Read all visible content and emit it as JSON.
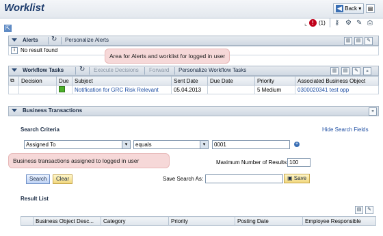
{
  "header": {
    "title": "Worklist",
    "back_label": "Back",
    "alert_count": "(1)"
  },
  "alerts": {
    "title": "Alerts",
    "personalize_label": "Personalize Alerts",
    "no_result": "No result found"
  },
  "callouts": {
    "alerts": "Area for Alerts and worklist for logged in user",
    "business": "Business transactions assigned to logged in user"
  },
  "workflow": {
    "title": "Workflow Tasks",
    "execute_label": "Execute Decisions",
    "forward_label": "Forward",
    "personalize_label": "Personalize Workflow Tasks",
    "columns": [
      "Decision",
      "Due",
      "Subject",
      "Sent Date",
      "Due Date",
      "Priority",
      "Associated Business Object"
    ],
    "rows": [
      {
        "decision": "",
        "subject": "Notification for GRC Risk Relevant",
        "sent_date": "05.04.2013",
        "due_date": "",
        "priority": "5 Medium",
        "object": "0300020341 test opp"
      }
    ]
  },
  "business": {
    "title": "Business Transactions",
    "search_criteria": "Search Criteria",
    "hide_search": "Hide Search Fields",
    "field": "Assigned To",
    "operator": "equals",
    "value": "0001",
    "max_results_label": "Maximum Number of Results:",
    "max_results_value": "100",
    "search_label": "Search",
    "clear_label": "Clear",
    "save_search_label": "Save Search As:",
    "save_search_value": "",
    "save_label": "Save",
    "result_list": "Result List",
    "result_columns": [
      "Business Object Desc...",
      "Category",
      "Priority",
      "Posting Date",
      "Employee Responsible"
    ]
  }
}
